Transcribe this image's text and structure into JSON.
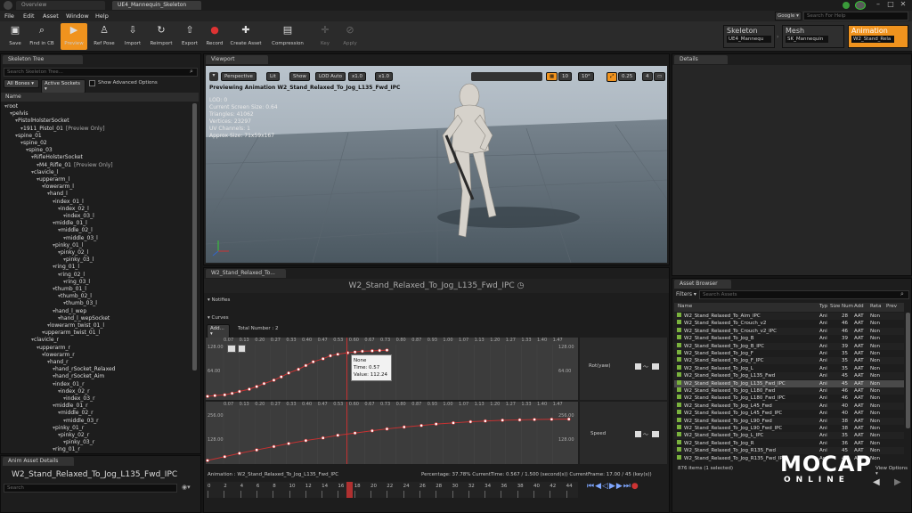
{
  "window_tabs": [
    "Overview",
    "UE4_Mannequin_Skeleton"
  ],
  "search_help_placeholder": "Search For Help",
  "google_label": "Google",
  "menu": [
    "File",
    "Edit",
    "Asset",
    "Window",
    "Help"
  ],
  "toolbar": [
    {
      "label": "Save",
      "icon": "save-icon"
    },
    {
      "label": "Find in CB",
      "icon": "find-icon"
    },
    {
      "label": "Preview",
      "icon": "preview-icon"
    },
    {
      "label": "Ref Pose",
      "icon": "ref-pose-icon"
    },
    {
      "label": "Import",
      "icon": "import-icon"
    },
    {
      "label": "Reimport",
      "icon": "reimport-icon"
    },
    {
      "label": "Export",
      "icon": "export-icon"
    },
    {
      "label": "Record",
      "icon": "record-icon"
    },
    {
      "label": "Create Asset",
      "icon": "create-asset-icon"
    },
    {
      "label": "Compression",
      "icon": "compression-icon"
    },
    {
      "label": "Key",
      "icon": "key-icon"
    },
    {
      "label": "Apply",
      "icon": "apply-icon"
    }
  ],
  "modes": [
    {
      "title": "Skeleton",
      "value": "UE4_Mannequ"
    },
    {
      "title": "Mesh",
      "value": "SK_Mannequin"
    },
    {
      "title": "Animation",
      "value": "W2_Stand_Rela"
    }
  ],
  "skeleton_tree": {
    "tab": "Skeleton Tree",
    "search_placeholder": "Search Skeleton Tree...",
    "filter_bones": "All Bones",
    "filter_sockets": "Active Sockets",
    "show_advanced": "Show Advanced Options",
    "column_name": "Name",
    "rows": [
      {
        "label": "root",
        "indent": 0
      },
      {
        "label": "pelvis",
        "indent": 1
      },
      {
        "label": "PistolHolsterSocket",
        "indent": 2
      },
      {
        "label": "1911_Pistol_01",
        "suffix": "[Preview Only]",
        "indent": 3
      },
      {
        "label": "spine_01",
        "indent": 2
      },
      {
        "label": "spine_02",
        "indent": 3
      },
      {
        "label": "spine_03",
        "indent": 4
      },
      {
        "label": "RifleHolsterSocket",
        "indent": 5
      },
      {
        "label": "M4_Rifle_01",
        "suffix": "[Preview Only]",
        "indent": 6
      },
      {
        "label": "clavicle_l",
        "indent": 5
      },
      {
        "label": "upperarm_l",
        "indent": 6
      },
      {
        "label": "lowerarm_l",
        "indent": 7
      },
      {
        "label": "hand_l",
        "indent": 8
      },
      {
        "label": "index_01_l",
        "indent": 9
      },
      {
        "label": "index_02_l",
        "indent": 10
      },
      {
        "label": "index_03_l",
        "indent": 11
      },
      {
        "label": "middle_01_l",
        "indent": 9
      },
      {
        "label": "middle_02_l",
        "indent": 10
      },
      {
        "label": "middle_03_l",
        "indent": 11
      },
      {
        "label": "pinky_01_l",
        "indent": 9
      },
      {
        "label": "pinky_02_l",
        "indent": 10
      },
      {
        "label": "pinky_03_l",
        "indent": 11
      },
      {
        "label": "ring_01_l",
        "indent": 9
      },
      {
        "label": "ring_02_l",
        "indent": 10
      },
      {
        "label": "ring_03_l",
        "indent": 11
      },
      {
        "label": "thumb_01_l",
        "indent": 9
      },
      {
        "label": "thumb_02_l",
        "indent": 10
      },
      {
        "label": "thumb_03_l",
        "indent": 11
      },
      {
        "label": "hand_l_wep",
        "indent": 9
      },
      {
        "label": "hand_l_wepSocket",
        "indent": 10
      },
      {
        "label": "lowerarm_twist_01_l",
        "indent": 8
      },
      {
        "label": "upperarm_twist_01_l",
        "indent": 7
      },
      {
        "label": "clavicle_r",
        "indent": 5
      },
      {
        "label": "upperarm_r",
        "indent": 6
      },
      {
        "label": "lowerarm_r",
        "indent": 7
      },
      {
        "label": "hand_r",
        "indent": 8
      },
      {
        "label": "hand_rSocket_Relaxed",
        "indent": 9
      },
      {
        "label": "hand_rSocket_Aim",
        "indent": 9
      },
      {
        "label": "index_01_r",
        "indent": 9
      },
      {
        "label": "index_02_r",
        "indent": 10
      },
      {
        "label": "index_03_r",
        "indent": 11
      },
      {
        "label": "middle_01_r",
        "indent": 9
      },
      {
        "label": "middle_02_r",
        "indent": 10
      },
      {
        "label": "middle_03_r",
        "indent": 11
      },
      {
        "label": "pinky_01_r",
        "indent": 9
      },
      {
        "label": "pinky_02_r",
        "indent": 10
      },
      {
        "label": "pinky_03_r",
        "indent": 11
      },
      {
        "label": "ring_01_r",
        "indent": 9
      }
    ]
  },
  "anim_details": {
    "tab": "Anim Asset Details",
    "asset_name": "W2_Stand_Relaxed_To_Jog_L135_Fwd_IPC",
    "search_placeholder": "Search"
  },
  "viewport": {
    "tab": "Viewport",
    "perspective": "Perspective",
    "lit": "Lit",
    "show": "Show",
    "lod": "LOD Auto",
    "speed": "x1.0",
    "speed2": "x1.0",
    "grid_snap": "10",
    "rot_snap": "10°",
    "scale_snap": "0.25",
    "cam_speed": "4",
    "previewing": "Previewing Animation W2_Stand_Relaxed_To_Jog_L135_Fwd_IPC",
    "stats": [
      "LOD: 0",
      "Current Screen Size: 0.64",
      "Triangles: 41062",
      "Vertices: 23297",
      "UV Channels: 1",
      "Approx Size: 71x59x167"
    ]
  },
  "details_tab": "Details",
  "sequence": {
    "tab": "W2_Stand_Relaxed_To...",
    "title": "W2_Stand_Relaxed_To_Jog_L135_Fwd_IPC",
    "notifies": "Notifies",
    "curves": "Curves",
    "add": "Add...",
    "total": "Total Number : 2",
    "top_ticks": [
      "0.07",
      "0.13",
      "0.20",
      "0.27",
      "0.33",
      "0.40",
      "0.47",
      "0.53",
      "0.60",
      "0.67",
      "0.73",
      "0.80",
      "0.87",
      "0.93",
      "1.00",
      "1.07",
      "1.13",
      "1.20",
      "1.27",
      "1.33",
      "1.40",
      "1.47"
    ],
    "curve1": {
      "name": "Rot(yaw)",
      "left_top": "128.00",
      "left_mid": "64.00",
      "right_top": "128.00",
      "right_mid": "64.00"
    },
    "curve2": {
      "name": "Speed",
      "left_top": "256.00",
      "left_mid": "128.00",
      "right_top": "256.00",
      "right_mid": "128.00"
    },
    "tooltip": [
      "None",
      "Time: 0.57",
      "Value: 112.24"
    ],
    "status_left": "Animation : W2_Stand_Relaxed_To_Jog_L135_Fwd_IPC",
    "status_right": "Percentage: 37.78% CurrentTime: 0.567 / 1.500 (second(s)) CurrentFrame: 17.00 / 45 (key(s))",
    "frame_ticks": [
      "0",
      "2",
      "4",
      "6",
      "8",
      "10",
      "12",
      "14",
      "16",
      "18",
      "20",
      "22",
      "24",
      "26",
      "28",
      "30",
      "32",
      "34",
      "36",
      "38",
      "40",
      "42",
      "44"
    ]
  },
  "chart_data": {
    "type": "scatter",
    "series": [
      {
        "name": "Rot(yaw)",
        "x": [
          0.0,
          0.03,
          0.07,
          0.1,
          0.13,
          0.17,
          0.2,
          0.23,
          0.27,
          0.3,
          0.33,
          0.37,
          0.4,
          0.43,
          0.47,
          0.5,
          0.53,
          0.57,
          0.6,
          0.63,
          0.67,
          0.7,
          0.73
        ],
        "y": [
          0,
          2,
          4,
          8,
          13,
          19,
          26,
          34,
          43,
          52,
          62,
          72,
          82,
          92,
          100,
          108,
          112,
          116,
          118,
          120,
          121,
          122,
          123
        ]
      },
      {
        "name": "Speed",
        "x": [
          0.0,
          0.07,
          0.13,
          0.2,
          0.27,
          0.33,
          0.4,
          0.47,
          0.53,
          0.6,
          0.67,
          0.73,
          0.8,
          0.87,
          0.93,
          1.0,
          1.07,
          1.13,
          1.2,
          1.27,
          1.33,
          1.4,
          1.47
        ],
        "y": [
          0,
          20,
          38,
          56,
          74,
          90,
          106,
          120,
          134,
          146,
          158,
          168,
          178,
          186,
          194,
          200,
          206,
          210,
          214,
          216,
          218,
          219,
          220
        ]
      }
    ],
    "xlim": [
      0,
      1.5
    ]
  },
  "asset_browser": {
    "tab": "Asset Browser",
    "filters": "Filters",
    "search_placeholder": "Search Assets",
    "columns": [
      "Name",
      "Typ",
      "Size",
      "Num",
      "Add",
      "Reta",
      "Prev"
    ],
    "rows": [
      {
        "name": "W2_Stand_Relaxed_To_Aim_IPC",
        "typ": "Ani",
        "num": "28",
        "add": "AAT",
        "reta": "Non"
      },
      {
        "name": "W2_Stand_Relaxed_To_Crouch_v2",
        "typ": "Ani",
        "num": "46",
        "add": "AAT",
        "reta": "Non"
      },
      {
        "name": "W2_Stand_Relaxed_To_Crouch_v2_IPC",
        "typ": "Ani",
        "num": "46",
        "add": "AAT",
        "reta": "Non"
      },
      {
        "name": "W2_Stand_Relaxed_To_Jog_B",
        "typ": "Ani",
        "num": "39",
        "add": "AAT",
        "reta": "Non"
      },
      {
        "name": "W2_Stand_Relaxed_To_Jog_B_IPC",
        "typ": "Ani",
        "num": "39",
        "add": "AAT",
        "reta": "Non"
      },
      {
        "name": "W2_Stand_Relaxed_To_Jog_F",
        "typ": "Ani",
        "num": "35",
        "add": "AAT",
        "reta": "Non"
      },
      {
        "name": "W2_Stand_Relaxed_To_Jog_F_IPC",
        "typ": "Ani",
        "num": "35",
        "add": "AAT",
        "reta": "Non"
      },
      {
        "name": "W2_Stand_Relaxed_To_Jog_L",
        "typ": "Ani",
        "num": "35",
        "add": "AAT",
        "reta": "Non"
      },
      {
        "name": "W2_Stand_Relaxed_To_Jog_L135_Fwd",
        "typ": "Ani",
        "num": "45",
        "add": "AAT",
        "reta": "Non"
      },
      {
        "name": "W2_Stand_Relaxed_To_Jog_L135_Fwd_IPC",
        "typ": "Ani",
        "num": "45",
        "add": "AAT",
        "reta": "Non",
        "selected": true
      },
      {
        "name": "W2_Stand_Relaxed_To_Jog_L180_Fwd",
        "typ": "Ani",
        "num": "46",
        "add": "AAT",
        "reta": "Non"
      },
      {
        "name": "W2_Stand_Relaxed_To_Jog_L180_Fwd_IPC",
        "typ": "Ani",
        "num": "46",
        "add": "AAT",
        "reta": "Non"
      },
      {
        "name": "W2_Stand_Relaxed_To_Jog_L45_Fwd",
        "typ": "Ani",
        "num": "40",
        "add": "AAT",
        "reta": "Non"
      },
      {
        "name": "W2_Stand_Relaxed_To_Jog_L45_Fwd_IPC",
        "typ": "Ani",
        "num": "40",
        "add": "AAT",
        "reta": "Non"
      },
      {
        "name": "W2_Stand_Relaxed_To_Jog_L90_Fwd",
        "typ": "Ani",
        "num": "38",
        "add": "AAT",
        "reta": "Non"
      },
      {
        "name": "W2_Stand_Relaxed_To_Jog_L90_Fwd_IPC",
        "typ": "Ani",
        "num": "38",
        "add": "AAT",
        "reta": "Non"
      },
      {
        "name": "W2_Stand_Relaxed_To_Jog_L_IPC",
        "typ": "Ani",
        "num": "35",
        "add": "AAT",
        "reta": "Non"
      },
      {
        "name": "W2_Stand_Relaxed_To_Jog_R",
        "typ": "Ani",
        "num": "36",
        "add": "AAT",
        "reta": "Non"
      },
      {
        "name": "W2_Stand_Relaxed_To_Jog_R135_Fwd",
        "typ": "Ani",
        "num": "45",
        "add": "AAT",
        "reta": "Non"
      },
      {
        "name": "W2_Stand_Relaxed_To_Jog_R135_Fwd_IPC",
        "typ": "Ani",
        "num": "45",
        "add": "AAT",
        "reta": "Non"
      }
    ],
    "count": "876 items (1 selected)",
    "view_options": "View Options"
  },
  "watermark": {
    "line1": "MOCAP",
    "line2": "ONLINE"
  },
  "colors": {
    "accent": "#f0931e",
    "selected": "#4a4a4a",
    "curve_red": "#c83232",
    "asset_green": "#7ab23d"
  }
}
